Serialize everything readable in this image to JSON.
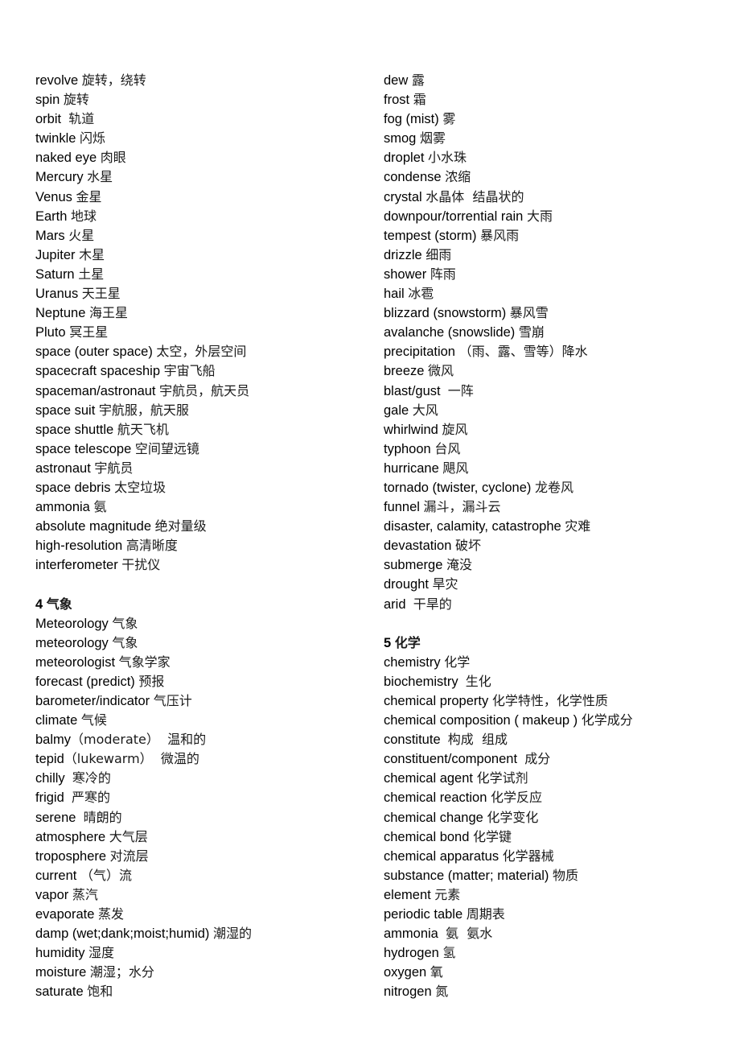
{
  "left_column": [
    {
      "en": "revolve ",
      "zh": "旋转，绕转"
    },
    {
      "en": "spin ",
      "zh": "旋转"
    },
    {
      "en": "orbit  ",
      "zh": "轨道"
    },
    {
      "en": "twinkle ",
      "zh": "闪烁"
    },
    {
      "en": "naked eye ",
      "zh": "肉眼"
    },
    {
      "en": "Mercury ",
      "zh": "水星"
    },
    {
      "en": "Venus ",
      "zh": "金星"
    },
    {
      "en": "Earth ",
      "zh": "地球"
    },
    {
      "en": "Mars ",
      "zh": "火星"
    },
    {
      "en": "Jupiter ",
      "zh": "木星"
    },
    {
      "en": "Saturn ",
      "zh": "土星"
    },
    {
      "en": "Uranus ",
      "zh": "天王星"
    },
    {
      "en": "Neptune ",
      "zh": "海王星"
    },
    {
      "en": "Pluto ",
      "zh": "冥王星"
    },
    {
      "en": "space (outer space) ",
      "zh": "太空，外层空间"
    },
    {
      "en": "spacecraft spaceship ",
      "zh": "宇宙飞船"
    },
    {
      "en": "spaceman/astronaut ",
      "zh": "宇航员，航天员"
    },
    {
      "en": "space suit ",
      "zh": "宇航服，航天服"
    },
    {
      "en": "space shuttle ",
      "zh": "航天飞机"
    },
    {
      "en": "space telescope ",
      "zh": "空间望远镜"
    },
    {
      "en": "astronaut ",
      "zh": "宇航员"
    },
    {
      "en": "space debris ",
      "zh": "太空垃圾"
    },
    {
      "en": "ammonia ",
      "zh": "氨"
    },
    {
      "en": "absolute magnitude ",
      "zh": "绝对量级"
    },
    {
      "en": "high-resolution ",
      "zh": "高清晰度"
    },
    {
      "en": "interferometer ",
      "zh": "干扰仪"
    }
  ],
  "section4": {
    "heading_num": "4 ",
    "heading_zh": "气象",
    "items": [
      {
        "en": "Meteorology ",
        "zh": "气象"
      },
      {
        "en": "meteorology ",
        "zh": "气象"
      },
      {
        "en": "meteorologist ",
        "zh": "气象学家"
      },
      {
        "en": "forecast (predict) ",
        "zh": "预报"
      },
      {
        "en": "barometer/indicator ",
        "zh": "气压计"
      },
      {
        "en": "climate ",
        "zh": "气候"
      },
      {
        "en": "balmy",
        "zh": "（moderate）  温和的"
      },
      {
        "en": "tepid",
        "zh": "（lukewarm）  微温的"
      },
      {
        "en": "chilly  ",
        "zh": "寒冷的"
      },
      {
        "en": "frigid  ",
        "zh": "严寒的"
      },
      {
        "en": "serene  ",
        "zh": "晴朗的"
      },
      {
        "en": "atmosphere ",
        "zh": "大气层"
      },
      {
        "en": "troposphere ",
        "zh": "对流层"
      },
      {
        "en": "current ",
        "zh": "（气）流"
      },
      {
        "en": "vapor ",
        "zh": "蒸汽"
      },
      {
        "en": "evaporate ",
        "zh": "蒸发"
      },
      {
        "en": "damp (wet;dank;moist;humid) ",
        "zh": "潮湿的"
      },
      {
        "en": "humidity ",
        "zh": "湿度"
      },
      {
        "en": "moisture ",
        "zh": "潮湿；水分"
      },
      {
        "en": "saturate ",
        "zh": "饱和"
      }
    ]
  },
  "right_column": [
    {
      "en": "dew ",
      "zh": "露"
    },
    {
      "en": "frost ",
      "zh": "霜"
    },
    {
      "en": "fog (mist) ",
      "zh": "雾"
    },
    {
      "en": "smog ",
      "zh": "烟雾"
    },
    {
      "en": "droplet ",
      "zh": "小水珠"
    },
    {
      "en": "condense ",
      "zh": "浓缩"
    },
    {
      "en": "crystal ",
      "zh": "水晶体  结晶状的"
    },
    {
      "en": "downpour/torrential rain ",
      "zh": "大雨"
    },
    {
      "en": "tempest (storm) ",
      "zh": "暴风雨"
    },
    {
      "en": "drizzle ",
      "zh": "细雨"
    },
    {
      "en": "shower ",
      "zh": "阵雨"
    },
    {
      "en": "hail ",
      "zh": "冰雹"
    },
    {
      "en": "blizzard (snowstorm) ",
      "zh": "暴风雪"
    },
    {
      "en": "avalanche (snowslide) ",
      "zh": "雪崩"
    },
    {
      "en": "precipitation ",
      "zh": "（雨、露、雪等）降水"
    },
    {
      "en": "breeze ",
      "zh": "微风"
    },
    {
      "en": "blast/gust  ",
      "zh": "一阵"
    },
    {
      "en": "gale ",
      "zh": "大风"
    },
    {
      "en": "whirlwind ",
      "zh": "旋风"
    },
    {
      "en": "typhoon ",
      "zh": "台风"
    },
    {
      "en": "hurricane ",
      "zh": "飓风"
    },
    {
      "en": "tornado (twister, cyclone) ",
      "zh": "龙卷风"
    },
    {
      "en": "funnel ",
      "zh": "漏斗，漏斗云"
    },
    {
      "en": "disaster, calamity, catastrophe ",
      "zh": "灾难"
    },
    {
      "en": "devastation ",
      "zh": "破坏"
    },
    {
      "en": "submerge ",
      "zh": "淹没"
    },
    {
      "en": "drought ",
      "zh": "旱灾"
    },
    {
      "en": "arid  ",
      "zh": "干旱的"
    }
  ],
  "section5": {
    "heading_num": "5 ",
    "heading_zh": "化学",
    "items": [
      {
        "en": "chemistry ",
        "zh": "化学"
      },
      {
        "en": "biochemistry  ",
        "zh": "生化"
      },
      {
        "en": "chemical property ",
        "zh": "化学特性，化学性质"
      },
      {
        "en": "chemical composition ( makeup ) ",
        "zh": "化学成分"
      },
      {
        "en": "constitute  ",
        "zh": "构成  组成"
      },
      {
        "en": "constituent/component  ",
        "zh": "成分"
      },
      {
        "en": "chemical agent ",
        "zh": "化学试剂"
      },
      {
        "en": "chemical reaction ",
        "zh": "化学反应"
      },
      {
        "en": "chemical change ",
        "zh": "化学变化"
      },
      {
        "en": "chemical bond ",
        "zh": "化学键"
      },
      {
        "en": "chemical apparatus ",
        "zh": "化学器械"
      },
      {
        "en": "substance (matter; material) ",
        "zh": "物质"
      },
      {
        "en": "element ",
        "zh": "元素"
      },
      {
        "en": "periodic table ",
        "zh": "周期表"
      },
      {
        "en": "ammonia  ",
        "zh": "氨  氨水"
      },
      {
        "en": "hydrogen ",
        "zh": "氢"
      },
      {
        "en": "oxygen ",
        "zh": "氧"
      },
      {
        "en": "nitrogen ",
        "zh": "氮"
      }
    ]
  }
}
